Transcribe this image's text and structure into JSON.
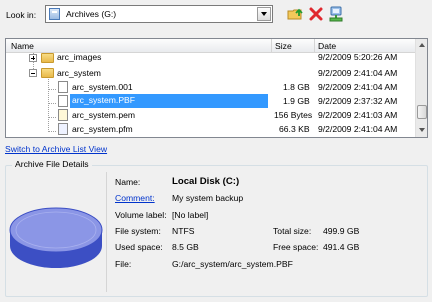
{
  "look_in": {
    "label": "Look in:",
    "value": "Archives (G:)"
  },
  "toolbar": {
    "icons": [
      "folder-up-icon",
      "delete-x-icon",
      "network-drive-icon"
    ]
  },
  "list": {
    "columns": [
      "Name",
      "Size",
      "Date"
    ],
    "rows": [
      {
        "name": "arc_images",
        "size": "",
        "date": "9/2/2009 5:20:26 AM",
        "type": "folder",
        "expander": "plus"
      },
      {
        "name": "arc_system",
        "size": "",
        "date": "9/2/2009 2:41:04 AM",
        "type": "folder",
        "expander": "minus"
      },
      {
        "name": "arc_system.001",
        "size": "1.8 GB",
        "date": "9/2/2009 2:41:04 AM",
        "type": "file"
      },
      {
        "name": "arc_system.PBF",
        "size": "1.9 GB",
        "date": "9/2/2009 2:37:32 AM",
        "type": "file",
        "selected": true
      },
      {
        "name": "arc_system.pem",
        "size": "156 Bytes",
        "date": "9/2/2009 2:41:03 AM",
        "type": "file"
      },
      {
        "name": "arc_system.pfm",
        "size": "66.3 KB",
        "date": "9/2/2009 2:41:04 AM",
        "type": "file"
      }
    ]
  },
  "switch_link": "Switch to Archive List View",
  "details": {
    "title": "Archive File Details",
    "name_label": "Name:",
    "name_value": "Local Disk (C:)",
    "comment_label": "Comment:",
    "comment_value": "My system backup",
    "volume_label": "Volume label:",
    "volume_value": "[No label]",
    "fs_label": "File system:",
    "fs_value": "NTFS",
    "total_label": "Total size:",
    "total_value": "499.9 GB",
    "used_label": "Used space:",
    "used_value": "8.5 GB",
    "free_label": "Free space:",
    "free_value": "491.4 GB",
    "file_label": "File:",
    "file_value": "G:/arc_system/arc_system.PBF"
  },
  "colors": {
    "selection": "#3399ff",
    "link": "#0033cc",
    "disk_top": "#8b96e6",
    "disk_side": "#3c4fc4"
  }
}
